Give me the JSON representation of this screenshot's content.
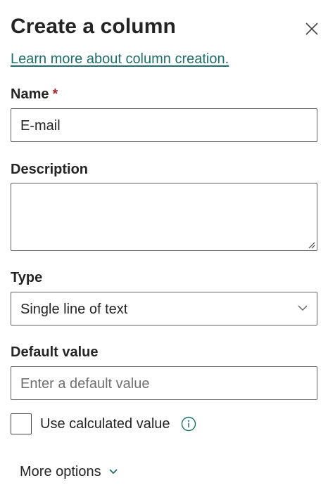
{
  "panel": {
    "title": "Create a column",
    "learn_more_link": "Learn more about column creation."
  },
  "name_field": {
    "label": "Name",
    "required_marker": "*",
    "value": "E-mail"
  },
  "description_field": {
    "label": "Description",
    "value": ""
  },
  "type_field": {
    "label": "Type",
    "selected": "Single line of text"
  },
  "default_value_field": {
    "label": "Default value",
    "placeholder": "Enter a default value"
  },
  "calculated_value": {
    "label": "Use calculated value",
    "checked": false
  },
  "more_options": {
    "label": "More options"
  },
  "colors": {
    "link": "#1e6f6a",
    "required": "#a4262c",
    "text": "#242424",
    "border": "#616161"
  },
  "icons": {
    "close": "close-icon",
    "dropdown": "chevron-down-icon",
    "info": "info-icon",
    "resize": "resize-grip-icon"
  }
}
